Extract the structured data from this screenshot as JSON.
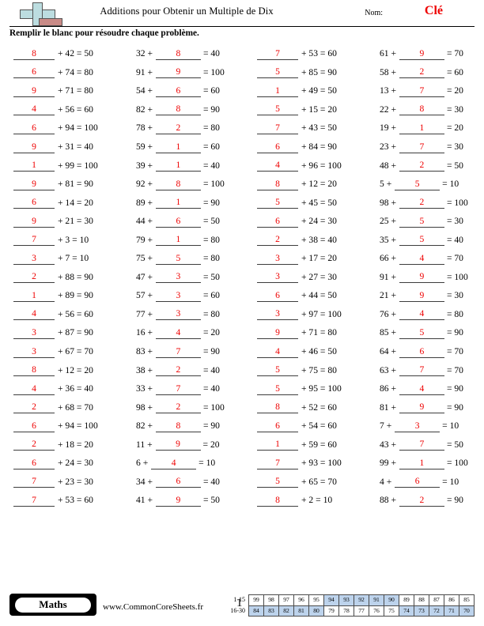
{
  "header": {
    "title": "Additions pour Obtenir un Multiple de Dix",
    "name_label": "Nom:",
    "name_value": "Clé",
    "instructions": "Remplir le blanc pour résoudre chaque problème.",
    "answer_color": "#ee0000",
    "logo": "plus-block-logo"
  },
  "columns": [
    {
      "id": "column-1",
      "layout": "blank-first",
      "problems": [
        {
          "blank": "8",
          "addend": "42",
          "sum": "50"
        },
        {
          "blank": "6",
          "addend": "74",
          "sum": "80"
        },
        {
          "blank": "9",
          "addend": "71",
          "sum": "80"
        },
        {
          "blank": "4",
          "addend": "56",
          "sum": "60"
        },
        {
          "blank": "6",
          "addend": "94",
          "sum": "100"
        },
        {
          "blank": "9",
          "addend": "31",
          "sum": "40"
        },
        {
          "blank": "1",
          "addend": "99",
          "sum": "100"
        },
        {
          "blank": "9",
          "addend": "81",
          "sum": "90"
        },
        {
          "blank": "6",
          "addend": "14",
          "sum": "20"
        },
        {
          "blank": "9",
          "addend": "21",
          "sum": "30"
        },
        {
          "blank": "7",
          "addend": "3",
          "sum": "10"
        },
        {
          "blank": "3",
          "addend": "7",
          "sum": "10"
        },
        {
          "blank": "2",
          "addend": "88",
          "sum": "90"
        },
        {
          "blank": "1",
          "addend": "89",
          "sum": "90"
        },
        {
          "blank": "4",
          "addend": "56",
          "sum": "60"
        },
        {
          "blank": "3",
          "addend": "87",
          "sum": "90"
        },
        {
          "blank": "3",
          "addend": "67",
          "sum": "70"
        },
        {
          "blank": "8",
          "addend": "12",
          "sum": "20"
        },
        {
          "blank": "4",
          "addend": "36",
          "sum": "40"
        },
        {
          "blank": "2",
          "addend": "68",
          "sum": "70"
        },
        {
          "blank": "6",
          "addend": "94",
          "sum": "100"
        },
        {
          "blank": "2",
          "addend": "18",
          "sum": "20"
        },
        {
          "blank": "6",
          "addend": "24",
          "sum": "30"
        },
        {
          "blank": "7",
          "addend": "23",
          "sum": "30"
        },
        {
          "blank": "7",
          "addend": "53",
          "sum": "60"
        }
      ]
    },
    {
      "id": "column-2",
      "layout": "blank-mid",
      "problems": [
        {
          "addend": "32",
          "blank": "8",
          "sum": "40"
        },
        {
          "addend": "91",
          "blank": "9",
          "sum": "100"
        },
        {
          "addend": "54",
          "blank": "6",
          "sum": "60"
        },
        {
          "addend": "82",
          "blank": "8",
          "sum": "90"
        },
        {
          "addend": "78",
          "blank": "2",
          "sum": "80"
        },
        {
          "addend": "59",
          "blank": "1",
          "sum": "60"
        },
        {
          "addend": "39",
          "blank": "1",
          "sum": "40"
        },
        {
          "addend": "92",
          "blank": "8",
          "sum": "100"
        },
        {
          "addend": "89",
          "blank": "1",
          "sum": "90"
        },
        {
          "addend": "44",
          "blank": "6",
          "sum": "50"
        },
        {
          "addend": "79",
          "blank": "1",
          "sum": "80"
        },
        {
          "addend": "75",
          "blank": "5",
          "sum": "80"
        },
        {
          "addend": "47",
          "blank": "3",
          "sum": "50"
        },
        {
          "addend": "57",
          "blank": "3",
          "sum": "60"
        },
        {
          "addend": "77",
          "blank": "3",
          "sum": "80"
        },
        {
          "addend": "16",
          "blank": "4",
          "sum": "20"
        },
        {
          "addend": "83",
          "blank": "7",
          "sum": "90"
        },
        {
          "addend": "38",
          "blank": "2",
          "sum": "40"
        },
        {
          "addend": "33",
          "blank": "7",
          "sum": "40"
        },
        {
          "addend": "98",
          "blank": "2",
          "sum": "100"
        },
        {
          "addend": "82",
          "blank": "8",
          "sum": "90"
        },
        {
          "addend": "11",
          "blank": "9",
          "sum": "20"
        },
        {
          "addend": "6",
          "blank": "4",
          "sum": "10"
        },
        {
          "addend": "34",
          "blank": "6",
          "sum": "40"
        },
        {
          "addend": "41",
          "blank": "9",
          "sum": "50"
        }
      ]
    },
    {
      "id": "column-3",
      "layout": "blank-first",
      "problems": [
        {
          "blank": "7",
          "addend": "53",
          "sum": "60"
        },
        {
          "blank": "5",
          "addend": "85",
          "sum": "90"
        },
        {
          "blank": "1",
          "addend": "49",
          "sum": "50"
        },
        {
          "blank": "5",
          "addend": "15",
          "sum": "20"
        },
        {
          "blank": "7",
          "addend": "43",
          "sum": "50"
        },
        {
          "blank": "6",
          "addend": "84",
          "sum": "90"
        },
        {
          "blank": "4",
          "addend": "96",
          "sum": "100"
        },
        {
          "blank": "8",
          "addend": "12",
          "sum": "20"
        },
        {
          "blank": "5",
          "addend": "45",
          "sum": "50"
        },
        {
          "blank": "6",
          "addend": "24",
          "sum": "30"
        },
        {
          "blank": "2",
          "addend": "38",
          "sum": "40"
        },
        {
          "blank": "3",
          "addend": "17",
          "sum": "20"
        },
        {
          "blank": "3",
          "addend": "27",
          "sum": "30"
        },
        {
          "blank": "6",
          "addend": "44",
          "sum": "50"
        },
        {
          "blank": "3",
          "addend": "97",
          "sum": "100"
        },
        {
          "blank": "9",
          "addend": "71",
          "sum": "80"
        },
        {
          "blank": "4",
          "addend": "46",
          "sum": "50"
        },
        {
          "blank": "5",
          "addend": "75",
          "sum": "80"
        },
        {
          "blank": "5",
          "addend": "95",
          "sum": "100"
        },
        {
          "blank": "8",
          "addend": "52",
          "sum": "60"
        },
        {
          "blank": "6",
          "addend": "54",
          "sum": "60"
        },
        {
          "blank": "1",
          "addend": "59",
          "sum": "60"
        },
        {
          "blank": "7",
          "addend": "93",
          "sum": "100"
        },
        {
          "blank": "5",
          "addend": "65",
          "sum": "70"
        },
        {
          "blank": "8",
          "addend": "2",
          "sum": "10"
        }
      ]
    },
    {
      "id": "column-4",
      "layout": "blank-mid",
      "problems": [
        {
          "addend": "61",
          "blank": "9",
          "sum": "70"
        },
        {
          "addend": "58",
          "blank": "2",
          "sum": "60"
        },
        {
          "addend": "13",
          "blank": "7",
          "sum": "20"
        },
        {
          "addend": "22",
          "blank": "8",
          "sum": "30"
        },
        {
          "addend": "19",
          "blank": "1",
          "sum": "20"
        },
        {
          "addend": "23",
          "blank": "7",
          "sum": "30"
        },
        {
          "addend": "48",
          "blank": "2",
          "sum": "50"
        },
        {
          "addend": "5",
          "blank": "5",
          "sum": "10"
        },
        {
          "addend": "98",
          "blank": "2",
          "sum": "100"
        },
        {
          "addend": "25",
          "blank": "5",
          "sum": "30"
        },
        {
          "addend": "35",
          "blank": "5",
          "sum": "40"
        },
        {
          "addend": "66",
          "blank": "4",
          "sum": "70"
        },
        {
          "addend": "91",
          "blank": "9",
          "sum": "100"
        },
        {
          "addend": "21",
          "blank": "9",
          "sum": "30"
        },
        {
          "addend": "76",
          "blank": "4",
          "sum": "80"
        },
        {
          "addend": "85",
          "blank": "5",
          "sum": "90"
        },
        {
          "addend": "64",
          "blank": "6",
          "sum": "70"
        },
        {
          "addend": "63",
          "blank": "7",
          "sum": "70"
        },
        {
          "addend": "86",
          "blank": "4",
          "sum": "90"
        },
        {
          "addend": "81",
          "blank": "9",
          "sum": "90"
        },
        {
          "addend": "7",
          "blank": "3",
          "sum": "10"
        },
        {
          "addend": "43",
          "blank": "7",
          "sum": "50"
        },
        {
          "addend": "99",
          "blank": "1",
          "sum": "100"
        },
        {
          "addend": "4",
          "blank": "6",
          "sum": "10"
        },
        {
          "addend": "88",
          "blank": "2",
          "sum": "90"
        }
      ]
    }
  ],
  "footer": {
    "subject": "Maths",
    "website": "www.CommonCoreSheets.fr",
    "page_number": "1",
    "score_table": {
      "highlight_color": "#bdd3ec",
      "rows": [
        {
          "label": "1-15",
          "cells": [
            {
              "v": "99",
              "hl": false
            },
            {
              "v": "98",
              "hl": false
            },
            {
              "v": "97",
              "hl": false
            },
            {
              "v": "96",
              "hl": false
            },
            {
              "v": "95",
              "hl": false
            },
            {
              "v": "94",
              "hl": true
            },
            {
              "v": "93",
              "hl": true
            },
            {
              "v": "92",
              "hl": true
            },
            {
              "v": "91",
              "hl": true
            },
            {
              "v": "90",
              "hl": true
            },
            {
              "v": "89",
              "hl": false
            },
            {
              "v": "88",
              "hl": false
            },
            {
              "v": "87",
              "hl": false
            },
            {
              "v": "86",
              "hl": false
            },
            {
              "v": "85",
              "hl": false
            }
          ]
        },
        {
          "label": "16-30",
          "cells": [
            {
              "v": "84",
              "hl": true
            },
            {
              "v": "83",
              "hl": true
            },
            {
              "v": "82",
              "hl": true
            },
            {
              "v": "81",
              "hl": true
            },
            {
              "v": "80",
              "hl": true
            },
            {
              "v": "79",
              "hl": false
            },
            {
              "v": "78",
              "hl": false
            },
            {
              "v": "77",
              "hl": false
            },
            {
              "v": "76",
              "hl": false
            },
            {
              "v": "75",
              "hl": false
            },
            {
              "v": "74",
              "hl": true
            },
            {
              "v": "73",
              "hl": true
            },
            {
              "v": "72",
              "hl": true
            },
            {
              "v": "71",
              "hl": true
            },
            {
              "v": "70",
              "hl": true
            }
          ]
        }
      ]
    }
  }
}
